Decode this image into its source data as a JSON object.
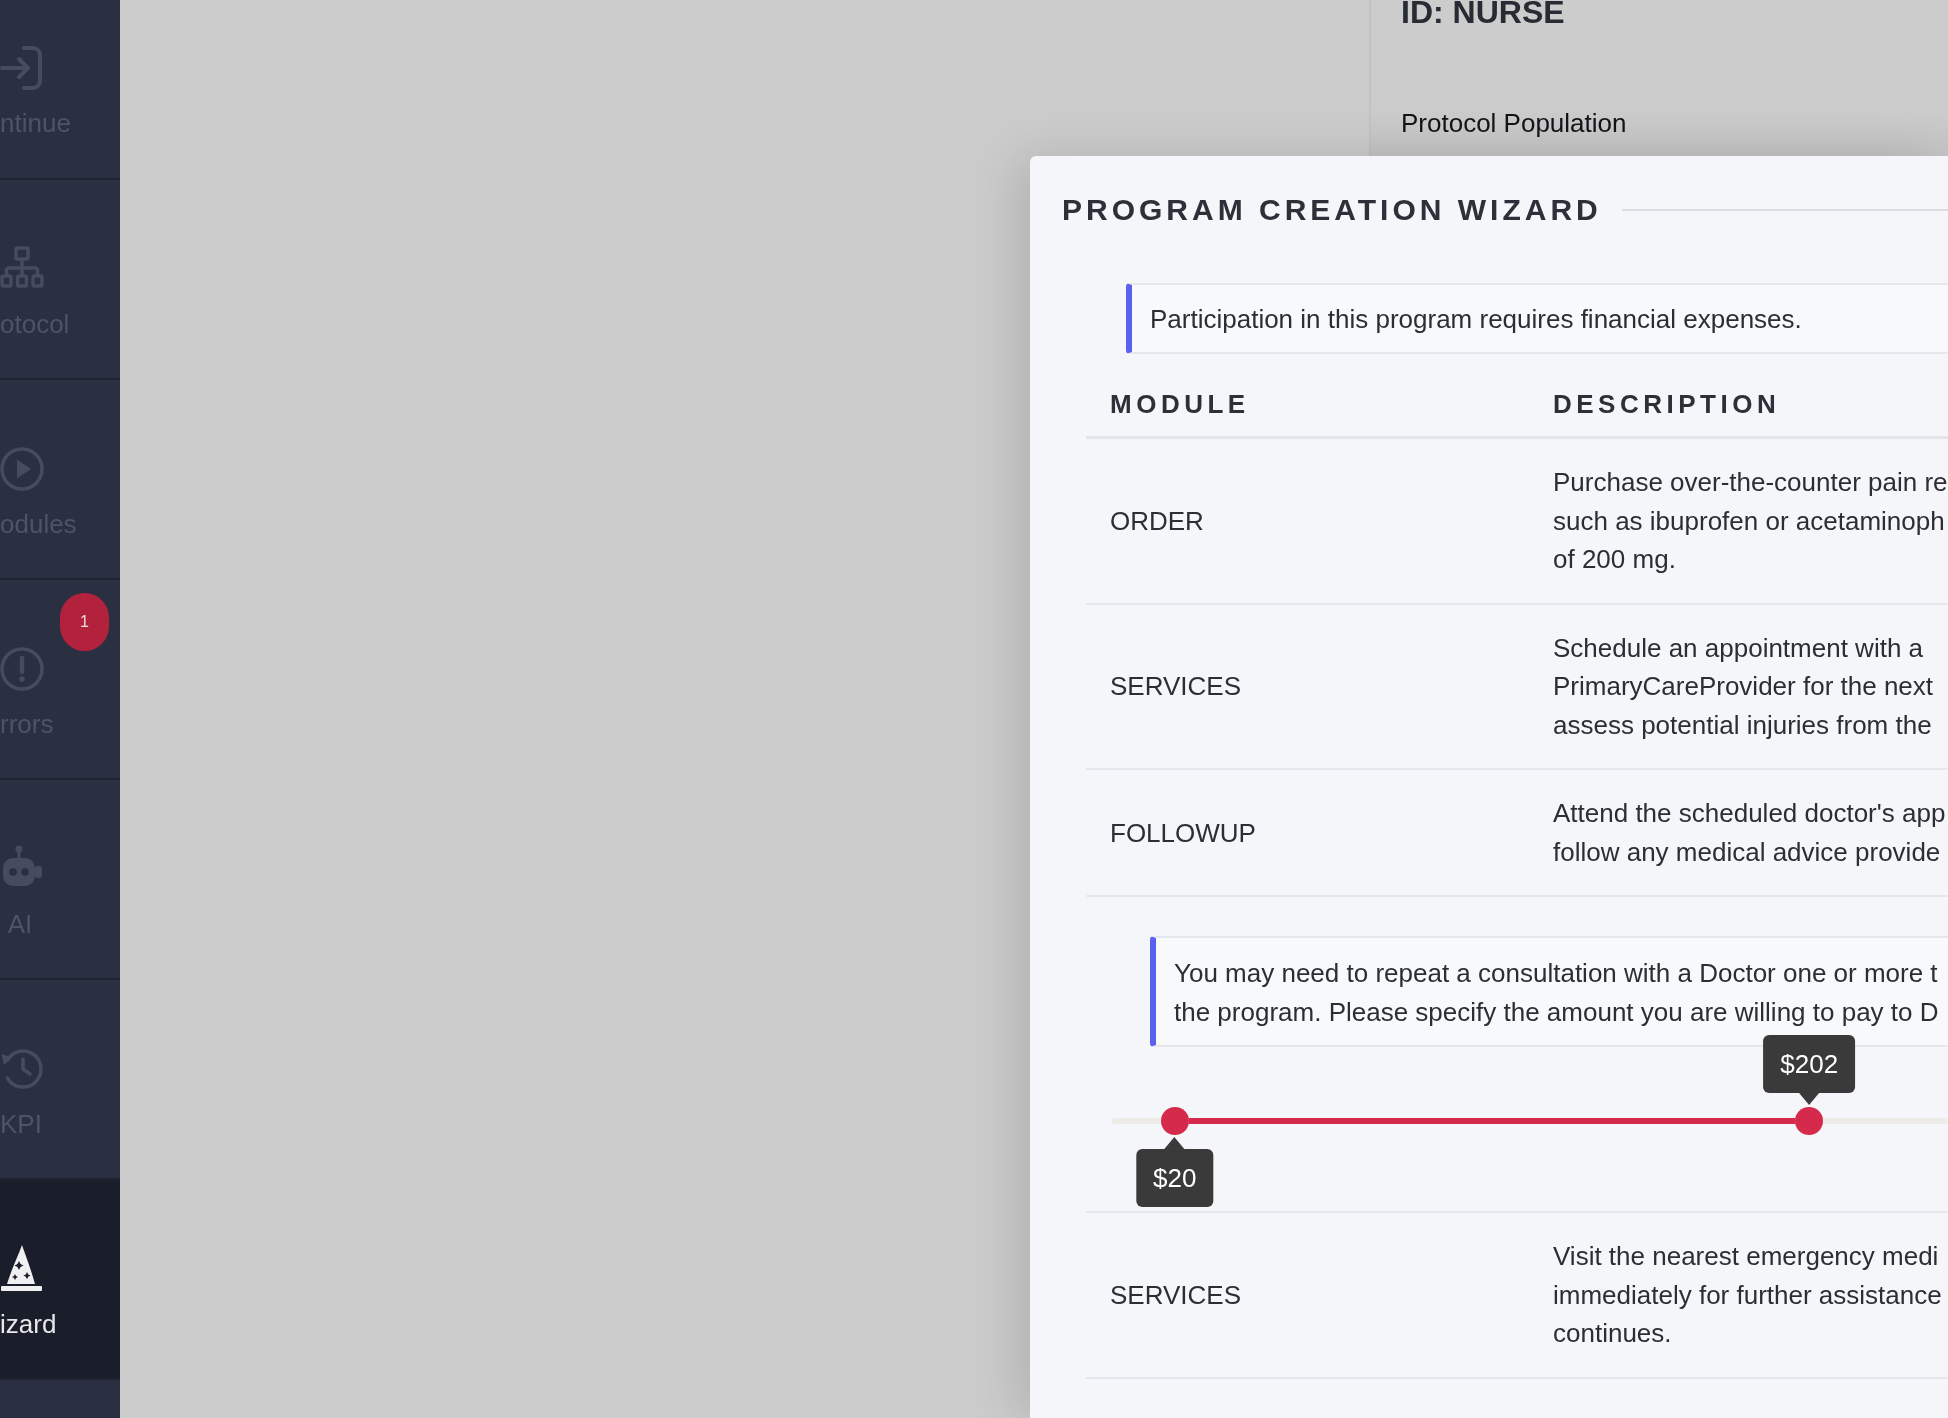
{
  "sidebar": {
    "items": [
      {
        "label": "ntinue",
        "selected": false
      },
      {
        "label": "otocol",
        "selected": false
      },
      {
        "label": "odules",
        "selected": false
      },
      {
        "label": "rrors",
        "selected": false,
        "badge": "1"
      },
      {
        "label": "AI",
        "selected": false
      },
      {
        "label": "KPI",
        "selected": false
      },
      {
        "label": "izard",
        "selected": true
      }
    ]
  },
  "page": {
    "title": "ID: NURSE",
    "subtitle": "Protocol Population"
  },
  "wizard": {
    "title": "PROGRAM CREATION WIZARD",
    "notice": "Participation in this program requires financial expenses.",
    "table": {
      "columns": [
        "MODULE",
        "DESCRIPTION"
      ],
      "rows": [
        {
          "kind": "module",
          "module": "ORDER",
          "description": [
            "Purchase over-the-counter pain re",
            "such as ibuprofen or acetaminoph",
            "of 200 mg."
          ]
        },
        {
          "kind": "module",
          "module": "SERVICES",
          "description": [
            "Schedule an appointment with a",
            "PrimaryCareProvider for the next",
            "assess potential injuries from the"
          ]
        },
        {
          "kind": "module",
          "module": "FOLLOWUP",
          "description": [
            "Attend the scheduled doctor's app",
            "follow any medical advice provide"
          ]
        },
        {
          "kind": "range",
          "notice": [
            "You may need to repeat a consultation with a Doctor one or more t",
            "the program. Please specify the amount you are willing to pay to D"
          ],
          "slider": {
            "low": {
              "level": 0.075,
              "value": "$20"
            },
            "high": {
              "level": 0.834,
              "value": "$202"
            }
          }
        },
        {
          "kind": "module",
          "module": "SERVICES",
          "description": [
            "Visit the nearest emergency medi",
            "immediately for further assistance",
            "continues."
          ]
        }
      ]
    }
  }
}
